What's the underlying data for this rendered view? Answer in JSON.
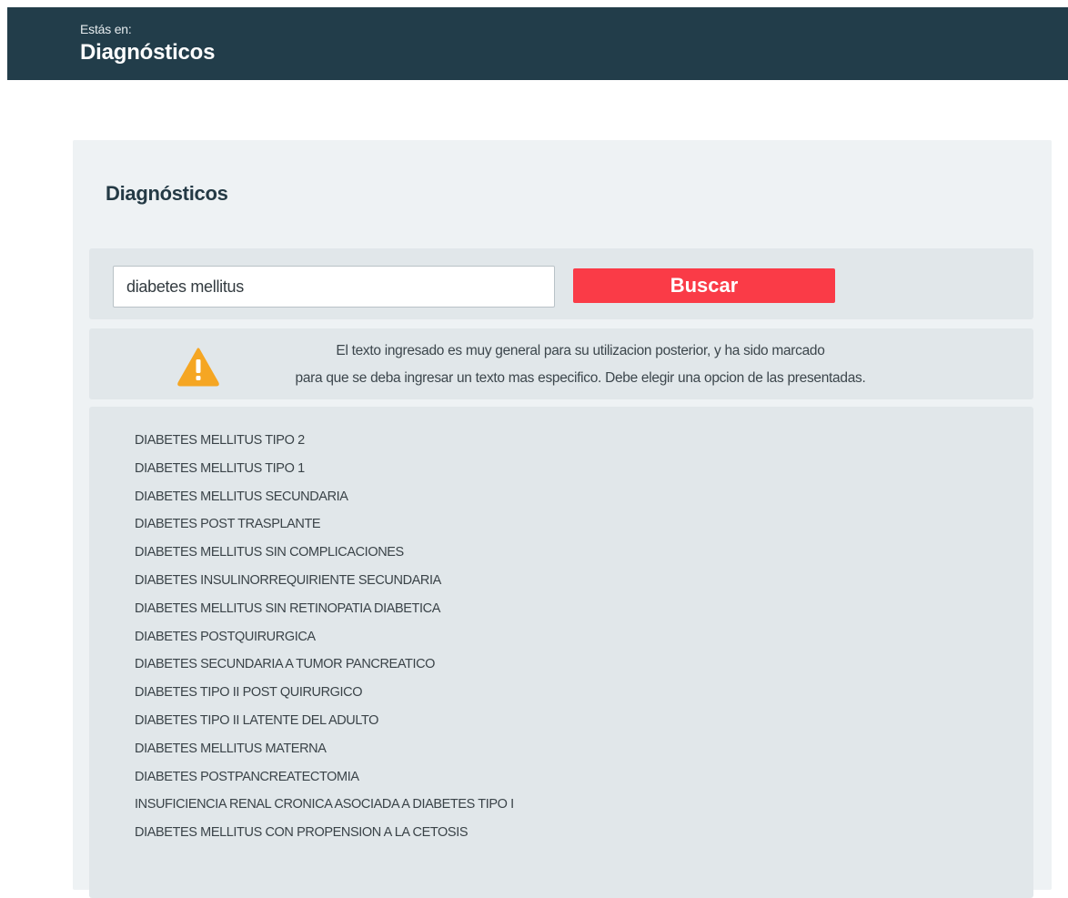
{
  "header": {
    "crumb": "Estás en:",
    "title": "Diagnósticos"
  },
  "panel": {
    "title": "Diagnósticos"
  },
  "search": {
    "value": "diabetes mellitus",
    "button_label": "Buscar"
  },
  "warning": {
    "icon": "warning-triangle-icon",
    "line1": "El texto ingresado es muy general para su utilizacion posterior, y ha sido marcado",
    "line2": "para que se deba ingresar un texto mas especifico. Debe elegir una opcion de las presentadas."
  },
  "results": [
    "DIABETES MELLITUS TIPO 2",
    "DIABETES MELLITUS TIPO 1",
    "DIABETES MELLITUS SECUNDARIA",
    "DIABETES POST TRASPLANTE",
    "DIABETES MELLITUS SIN COMPLICACIONES",
    "DIABETES INSULINORREQUIRIENTE SECUNDARIA",
    "DIABETES MELLITUS SIN RETINOPATIA DIABETICA",
    "DIABETES POSTQUIRURGICA",
    "DIABETES SECUNDARIA A TUMOR PANCREATICO",
    "DIABETES TIPO II POST QUIRURGICO",
    "DIABETES TIPO II LATENTE DEL ADULTO",
    "DIABETES MELLITUS MATERNA",
    "DIABETES POSTPANCREATECTOMIA",
    "INSUFICIENCIA RENAL CRONICA ASOCIADA A DIABETES TIPO I",
    "DIABETES MELLITUS CON PROPENSION A LA CETOSIS"
  ],
  "colors": {
    "header_bg": "#223d4a",
    "button_bg": "#fa3b47",
    "warning_icon": "#f5a623"
  }
}
